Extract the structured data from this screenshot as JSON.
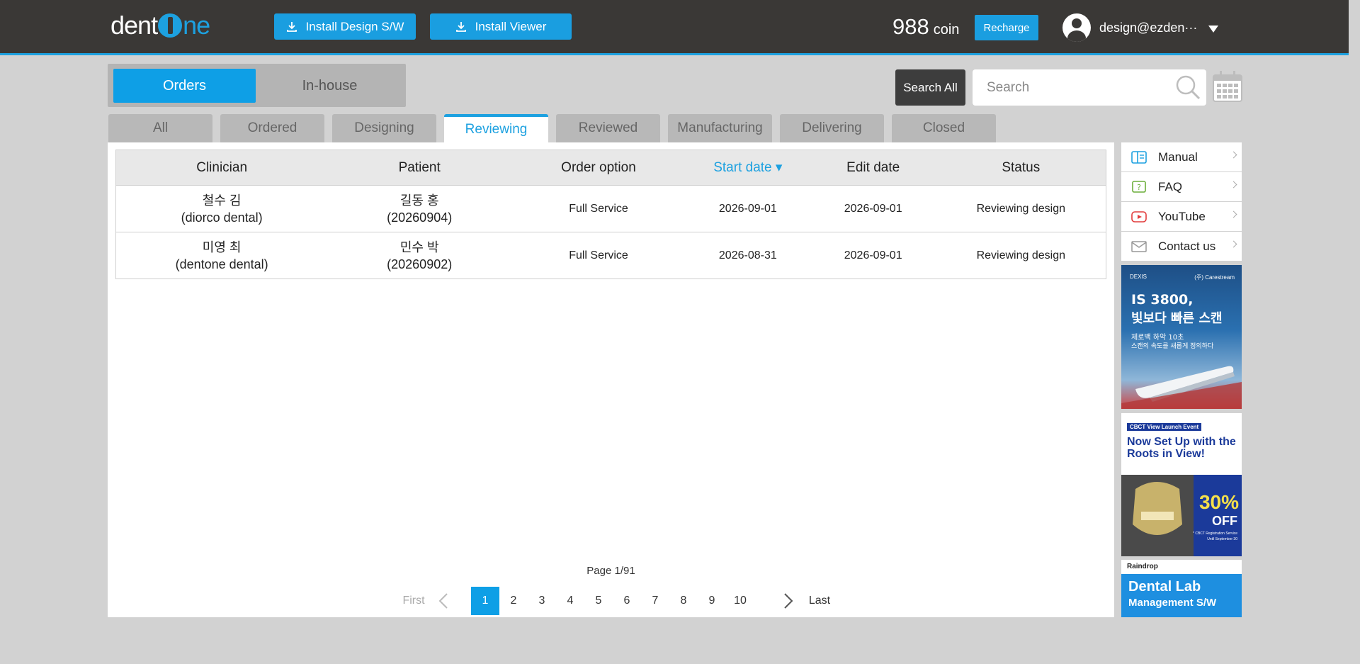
{
  "header": {
    "logo_left": "dent",
    "logo_right": "ne",
    "install_design_label": "Install Design S/W",
    "install_viewer_label": "Install Viewer",
    "coin_amount": "988",
    "coin_unit": "coin",
    "recharge_label": "Recharge",
    "user_email": "design@ezden···",
    "accent_color": "#1da1e0"
  },
  "mode_toggle": {
    "orders_label": "Orders",
    "inhouse_label": "In-house",
    "active": "Orders"
  },
  "search": {
    "search_all_label": "Search All",
    "placeholder": "Search"
  },
  "tabs": [
    {
      "label": "All"
    },
    {
      "label": "Ordered"
    },
    {
      "label": "Designing"
    },
    {
      "label": "Reviewing"
    },
    {
      "label": "Reviewed"
    },
    {
      "label": "Manufacturing"
    },
    {
      "label": "Delivering"
    },
    {
      "label": "Closed"
    }
  ],
  "active_tab": "Reviewing",
  "table": {
    "columns": {
      "clinician": "Clinician",
      "patient": "Patient",
      "order_option": "Order option",
      "start_date": "Start date ▾",
      "edit_date": "Edit date",
      "status": "Status"
    },
    "rows": [
      {
        "clinician_name": "철수 김",
        "clinician_org": "(diorco dental)",
        "patient_name": "길동 홍",
        "patient_id": "(20260904)",
        "order_option": "Full Service",
        "start_date": "2026-09-01",
        "edit_date": "2026-09-01",
        "status": "Reviewing design"
      },
      {
        "clinician_name": "미영 최",
        "clinician_org": "(dentone dental)",
        "patient_name": "민수 박",
        "patient_id": "(20260902)",
        "order_option": "Full Service",
        "start_date": "2026-08-31",
        "edit_date": "2026-09-01",
        "status": "Reviewing design"
      }
    ]
  },
  "pagination": {
    "page_info": "Page 1/91",
    "first_label": "First",
    "last_label": "Last",
    "pages": [
      "1",
      "2",
      "3",
      "4",
      "5",
      "6",
      "7",
      "8",
      "9",
      "10"
    ],
    "current": "1"
  },
  "side_menu": [
    {
      "label": "Manual",
      "icon": "book-icon"
    },
    {
      "label": "FAQ",
      "icon": "question-icon"
    },
    {
      "label": "YouTube",
      "icon": "youtube-icon"
    },
    {
      "label": "Contact us",
      "icon": "mail-icon"
    }
  ],
  "ads": {
    "ad1_brand_left": "DEXIS",
    "ad1_brand_right": "(주) Carestream",
    "ad1_title_line1": "IS 3800,",
    "ad1_title_line2": "빛보다 빠른 스캔",
    "ad1_sub_line1": "제로백 하악 10초",
    "ad1_sub_line2": "스캔의 속도를 새롭게 정의하다",
    "ad2_badge": "CBCT View Launch Event",
    "ad2_title": "Now Set Up with the Roots in View!",
    "ad2_discount": "30%",
    "ad2_off": "OFF",
    "ad2_fine_line1": "* CBCT Registration Service",
    "ad2_fine_line2": "Until September 30",
    "ad3_brand": "Raindrop",
    "ad3_title": "Dental Lab",
    "ad3_sub": "Management S/W"
  }
}
